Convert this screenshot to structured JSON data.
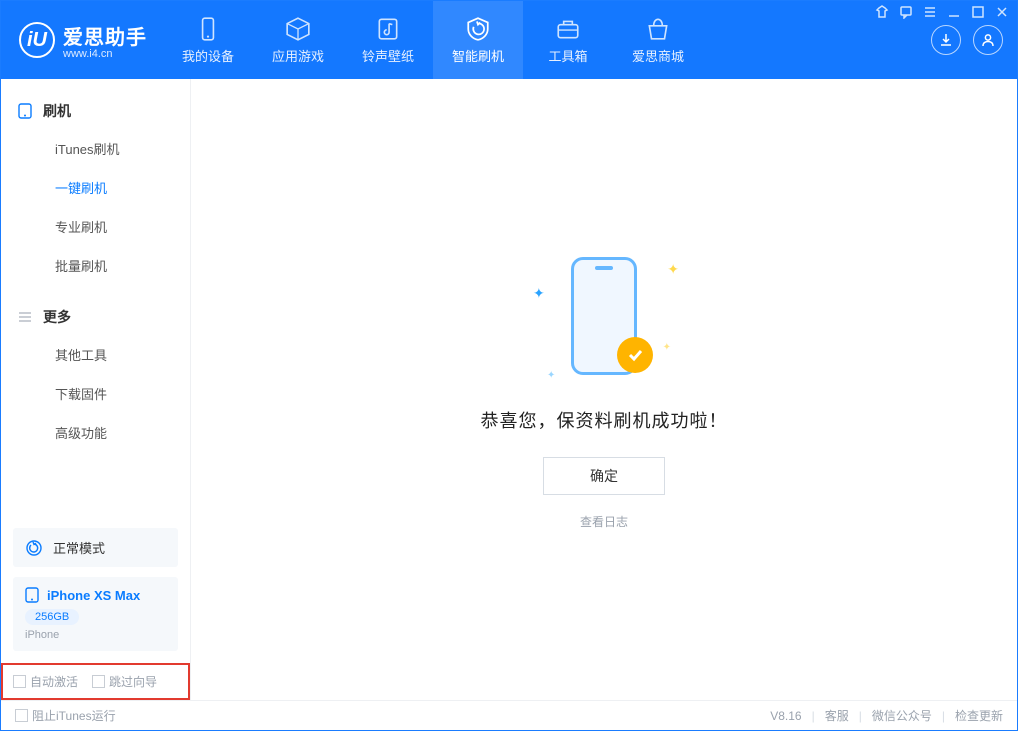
{
  "app": {
    "title": "爱思助手",
    "subtitle": "www.i4.cn"
  },
  "tabs": {
    "device": "我的设备",
    "apps": "应用游戏",
    "media": "铃声壁纸",
    "flash": "智能刷机",
    "toolbox": "工具箱",
    "store": "爱思商城"
  },
  "sidebar": {
    "group1_title": "刷机",
    "items1": [
      "iTunes刷机",
      "一键刷机",
      "专业刷机",
      "批量刷机"
    ],
    "group2_title": "更多",
    "items2": [
      "其他工具",
      "下载固件",
      "高级功能"
    ]
  },
  "mode": {
    "label": "正常模式"
  },
  "device": {
    "name": "iPhone XS Max",
    "capacity": "256GB",
    "type": "iPhone"
  },
  "options": {
    "auto_activate": "自动激活",
    "skip_guide": "跳过向导"
  },
  "result": {
    "message": "恭喜您，保资料刷机成功啦！",
    "ok_button": "确定",
    "view_log": "查看日志"
  },
  "footer": {
    "block_itunes": "阻止iTunes运行",
    "version": "V8.16",
    "support": "客服",
    "wechat": "微信公众号",
    "update": "检查更新"
  }
}
